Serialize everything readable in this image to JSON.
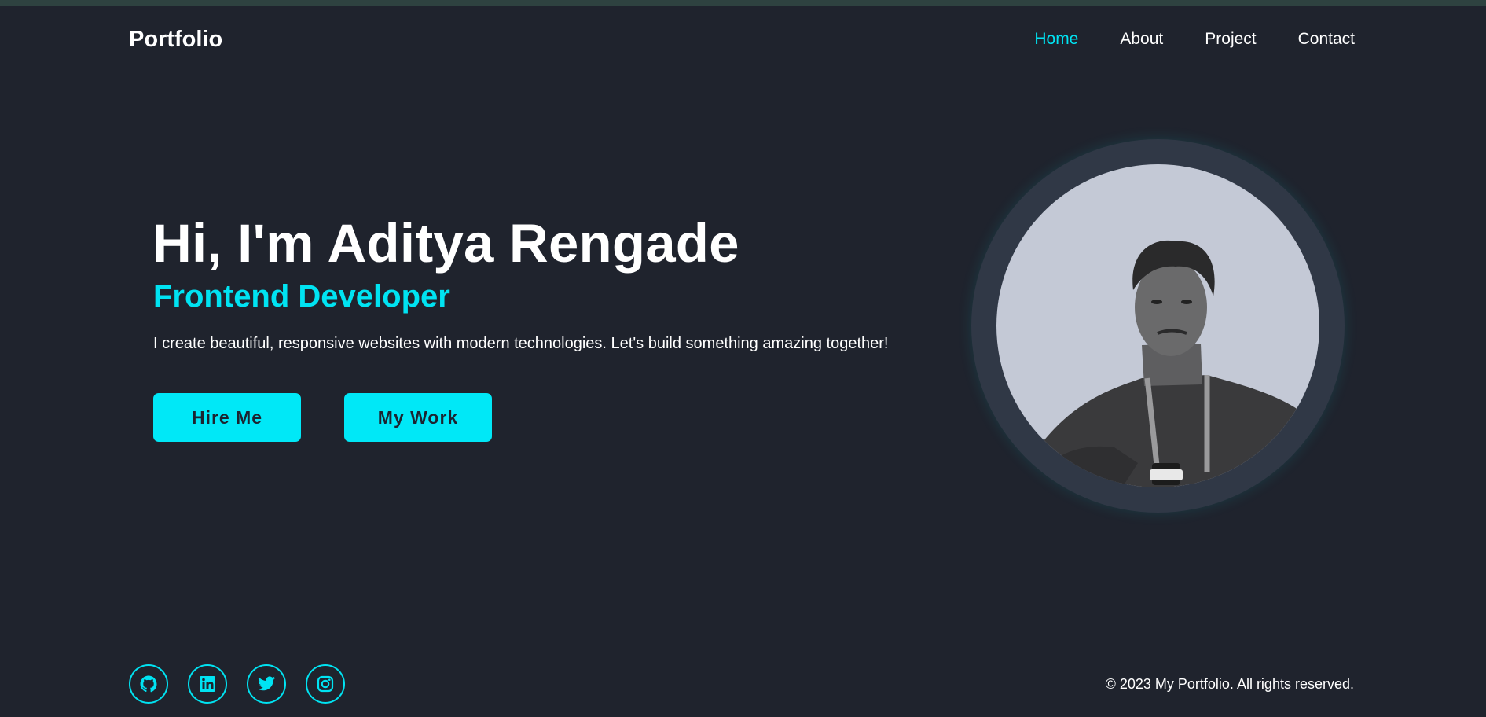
{
  "header": {
    "logo": "Portfolio",
    "nav": [
      {
        "label": "Home",
        "active": true
      },
      {
        "label": "About",
        "active": false
      },
      {
        "label": "Project",
        "active": false
      },
      {
        "label": "Contact",
        "active": false
      }
    ]
  },
  "hero": {
    "title": "Hi, I'm Aditya Rengade",
    "subtitle": "Frontend Developer",
    "description": "I create beautiful, responsive websites with modern technologies. Let's build something amazing together!",
    "buttons": {
      "hire": "Hire Me",
      "work": "My Work"
    }
  },
  "profile_photo": {
    "icon": "profile-photo"
  },
  "footer": {
    "socials": [
      {
        "icon": "github-icon"
      },
      {
        "icon": "linkedin-icon"
      },
      {
        "icon": "twitter-icon"
      },
      {
        "icon": "instagram-icon"
      }
    ],
    "copyright": "© 2023 My Portfolio. All rights reserved."
  },
  "colors": {
    "background": "#1f232d",
    "accent": "#00e3f2",
    "button_bg": "#00e8f7",
    "ring": "#303846"
  }
}
